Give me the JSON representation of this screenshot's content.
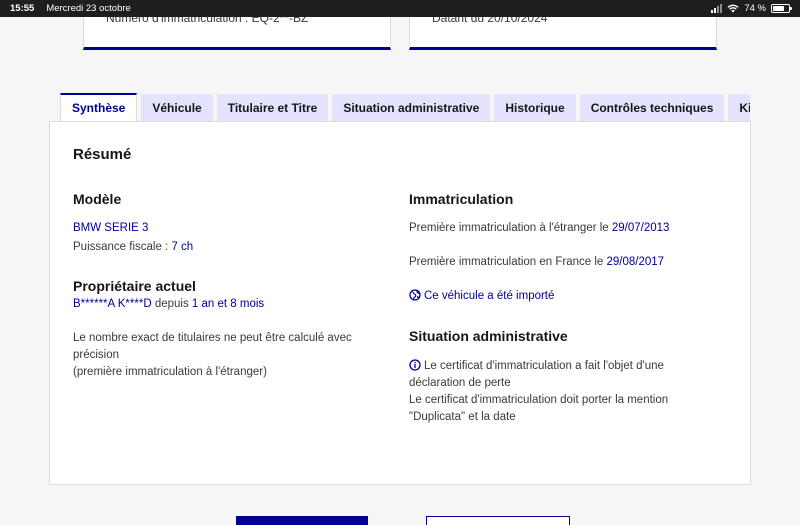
{
  "status_bar": {
    "time": "15:55",
    "date": "Mercredi 23 octobre",
    "battery": "74 %",
    "battery_level": 0.74
  },
  "top_cards": {
    "left_text": "Numéro d'immatriculation : EQ-2**-BZ",
    "right_text": "Datant du 20/10/2024"
  },
  "tabs": [
    {
      "label": "Synthèse",
      "active": true
    },
    {
      "label": "Véhicule"
    },
    {
      "label": "Titulaire et Titre"
    },
    {
      "label": "Situation administrative"
    },
    {
      "label": "Historique"
    },
    {
      "label": "Contrôles techniques"
    },
    {
      "label": "Kilo"
    }
  ],
  "summary": {
    "title": "Résumé",
    "model": {
      "heading": "Modèle",
      "name": "BMW SERIE 3",
      "power_label": "Puissance fiscale : ",
      "power_value": "7 ch"
    },
    "owner": {
      "heading": "Propriétaire actuel",
      "name": "B******A K****D",
      "since_label": " depuis ",
      "since_value": "1 an et 8 mois",
      "note_line1": "Le nombre exact de titulaires ne peut être calculé avec",
      "note_line2": "précision",
      "note_line3": "(première immatriculation à l'étranger)"
    },
    "registration": {
      "heading": "Immatriculation",
      "foreign_label": "Première immatriculation à l'étranger le ",
      "foreign_date": "29/07/2013",
      "france_label": "Première immatriculation en France le ",
      "france_date": "29/08/2017",
      "imported_text": "Ce véhicule a été importé"
    },
    "admin": {
      "heading": "Situation administrative",
      "line1": "Le certificat d'immatriculation a fait l'objet d'une",
      "line2": "déclaration de perte",
      "line3": "Le certificat d'immatriculation doit porter la mention",
      "line4": "\"Duplicata\" et la date"
    }
  },
  "colors": {
    "primary": "#000091",
    "tab_bg": "#e3e3fd",
    "text": "#161616",
    "muted": "#3a3a3a"
  }
}
